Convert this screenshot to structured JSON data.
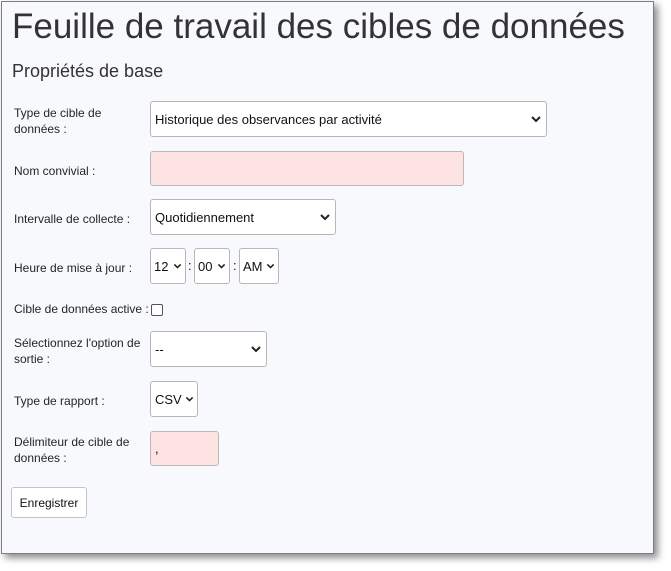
{
  "page": {
    "title": "Feuille de travail des cibles de données",
    "section_title": "Propriétés de base"
  },
  "form": {
    "target_type": {
      "label": "Type de cible de données :",
      "value": "Historique des observances par activité"
    },
    "friendly_name": {
      "label": "Nom convivial :",
      "value": ""
    },
    "collection_interval": {
      "label": "Intervalle de collecte :",
      "value": "Quotidiennement"
    },
    "update_time": {
      "label": "Heure de mise à jour :",
      "hour": "12",
      "minute": "00",
      "ampm": "AM",
      "separator": ":"
    },
    "active": {
      "label": "Cible de données active :",
      "checked": false
    },
    "output_option": {
      "label": "Sélectionnez l'option de sortie :",
      "value": "--"
    },
    "report_type": {
      "label": "Type de rapport :",
      "value": "CSV"
    },
    "delimiter": {
      "label": "Délimiteur de cible de données :",
      "value": ","
    },
    "save_button": "Enregistrer"
  },
  "colors": {
    "required_field_bg": "#fde4e2",
    "panel_bg": "#f8f9fc"
  }
}
